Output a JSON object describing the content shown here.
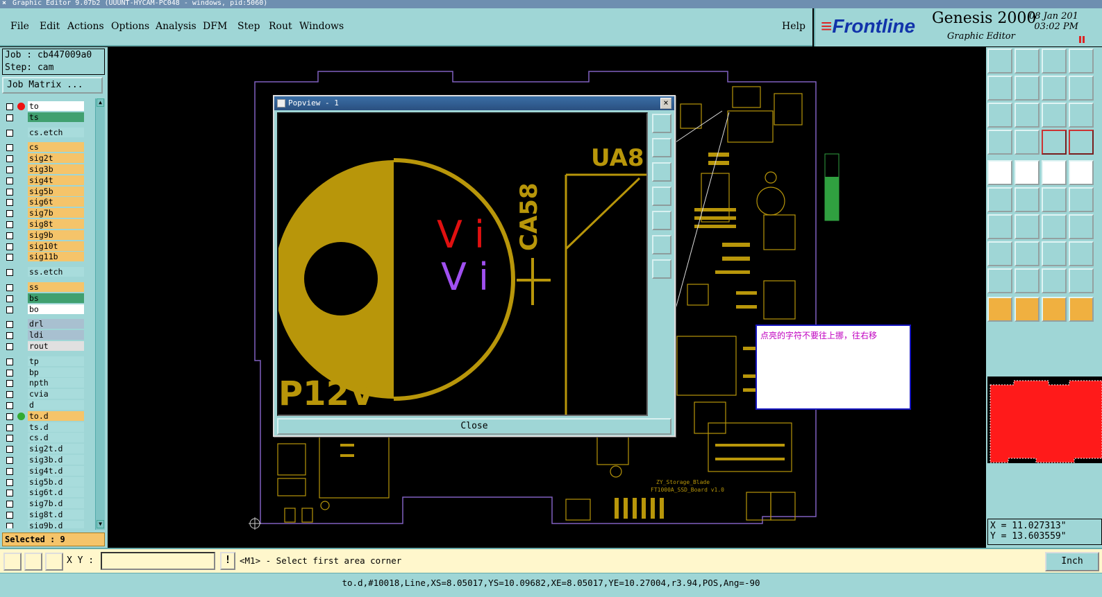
{
  "window": {
    "title": "Graphic Editor 9.07b2 (UUUNT-HYCAM-PC048 - windows, pid:5060)"
  },
  "menu": [
    "File",
    "Edit",
    "Actions",
    "Options",
    "Analysis",
    "DFM",
    "Step",
    "Rout",
    "Windows"
  ],
  "help_label": "Help",
  "brand": {
    "logo": "Frontline",
    "product": "Genesis 2000",
    "subtitle": "Graphic Editor",
    "date": "08 Jan 201",
    "time": "03:02 PM"
  },
  "job": {
    "job_line": "Job : cb447009a0",
    "step_line": "Step: cam",
    "matrix_button": "Job Matrix ..."
  },
  "layers": [
    {
      "name": "to",
      "color": "#ffffff"
    },
    {
      "name": "ts",
      "color": "#40a070"
    },
    {
      "name": "cs.etch",
      "color": "#a8dcdc"
    },
    {
      "name": "cs",
      "color": "#f5c46a"
    },
    {
      "name": "sig2t",
      "color": "#f5c46a"
    },
    {
      "name": "sig3b",
      "color": "#f5c46a"
    },
    {
      "name": "sig4t",
      "color": "#f5c46a"
    },
    {
      "name": "sig5b",
      "color": "#f5c46a"
    },
    {
      "name": "sig6t",
      "color": "#f5c46a"
    },
    {
      "name": "sig7b",
      "color": "#f5c46a"
    },
    {
      "name": "sig8t",
      "color": "#f5c46a"
    },
    {
      "name": "sig9b",
      "color": "#f5c46a"
    },
    {
      "name": "sig10t",
      "color": "#f5c46a"
    },
    {
      "name": "sig11b",
      "color": "#f5c46a"
    },
    {
      "name": "ss.etch",
      "color": "#a8dcdc"
    },
    {
      "name": "ss",
      "color": "#f5c46a"
    },
    {
      "name": "bs",
      "color": "#40a070"
    },
    {
      "name": "bo",
      "color": "#ffffff"
    },
    {
      "name": "drl",
      "color": "#a8c0d0"
    },
    {
      "name": "ldi",
      "color": "#a8c0d0"
    },
    {
      "name": "rout",
      "color": "#e0e0e0"
    },
    {
      "name": "tp",
      "color": "#a8dcdc"
    },
    {
      "name": "bp",
      "color": "#a8dcdc"
    },
    {
      "name": "npth",
      "color": "#a8dcdc"
    },
    {
      "name": "cvia",
      "color": "#a8dcdc"
    },
    {
      "name": "d",
      "color": "#a8dcdc"
    },
    {
      "name": "to.d",
      "color": "#f5c46a"
    },
    {
      "name": "ts.d",
      "color": "#a8dcdc"
    },
    {
      "name": "cs.d",
      "color": "#a8dcdc"
    },
    {
      "name": "sig2t.d",
      "color": "#a8dcdc"
    },
    {
      "name": "sig3b.d",
      "color": "#a8dcdc"
    },
    {
      "name": "sig4t.d",
      "color": "#a8dcdc"
    },
    {
      "name": "sig5b.d",
      "color": "#a8dcdc"
    },
    {
      "name": "sig6t.d",
      "color": "#a8dcdc"
    },
    {
      "name": "sig7b.d",
      "color": "#a8dcdc"
    },
    {
      "name": "sig8t.d",
      "color": "#a8dcdc"
    },
    {
      "name": "sig9b.d",
      "color": "#a8dcdc"
    }
  ],
  "selected": "Selected : 9",
  "popview": {
    "title": "Popview - 1",
    "close_label": "Close",
    "labels": {
      "ua": "UA8",
      "ca": "CA58",
      "pin": "P12V",
      "v1": "V",
      "i1": "i",
      "v2": "V",
      "i2": "i"
    }
  },
  "board_text": {
    "line1": "ZY_Storage_Blade",
    "line2": "FT1000A_SSD_Board v1.0"
  },
  "note": "点亮的字符不要往上挪，往右移",
  "coords": {
    "x": "X = 11.027313\"",
    "y": "Y = 13.603559\""
  },
  "bottom": {
    "xy_label": "X Y :",
    "prompt": "<M1> - Select first area corner",
    "units": "Inch",
    "warn": "!"
  },
  "status": "to.d,#10018,Line,XS=8.05017,YS=10.09682,XE=8.05017,YE=10.27004,r3.94,POS,Ang=-90",
  "colors": {
    "panel": "#9fd6d6",
    "copper": "#b8960a",
    "outline": "#8060c0",
    "minimap": "#ff1a1a"
  }
}
